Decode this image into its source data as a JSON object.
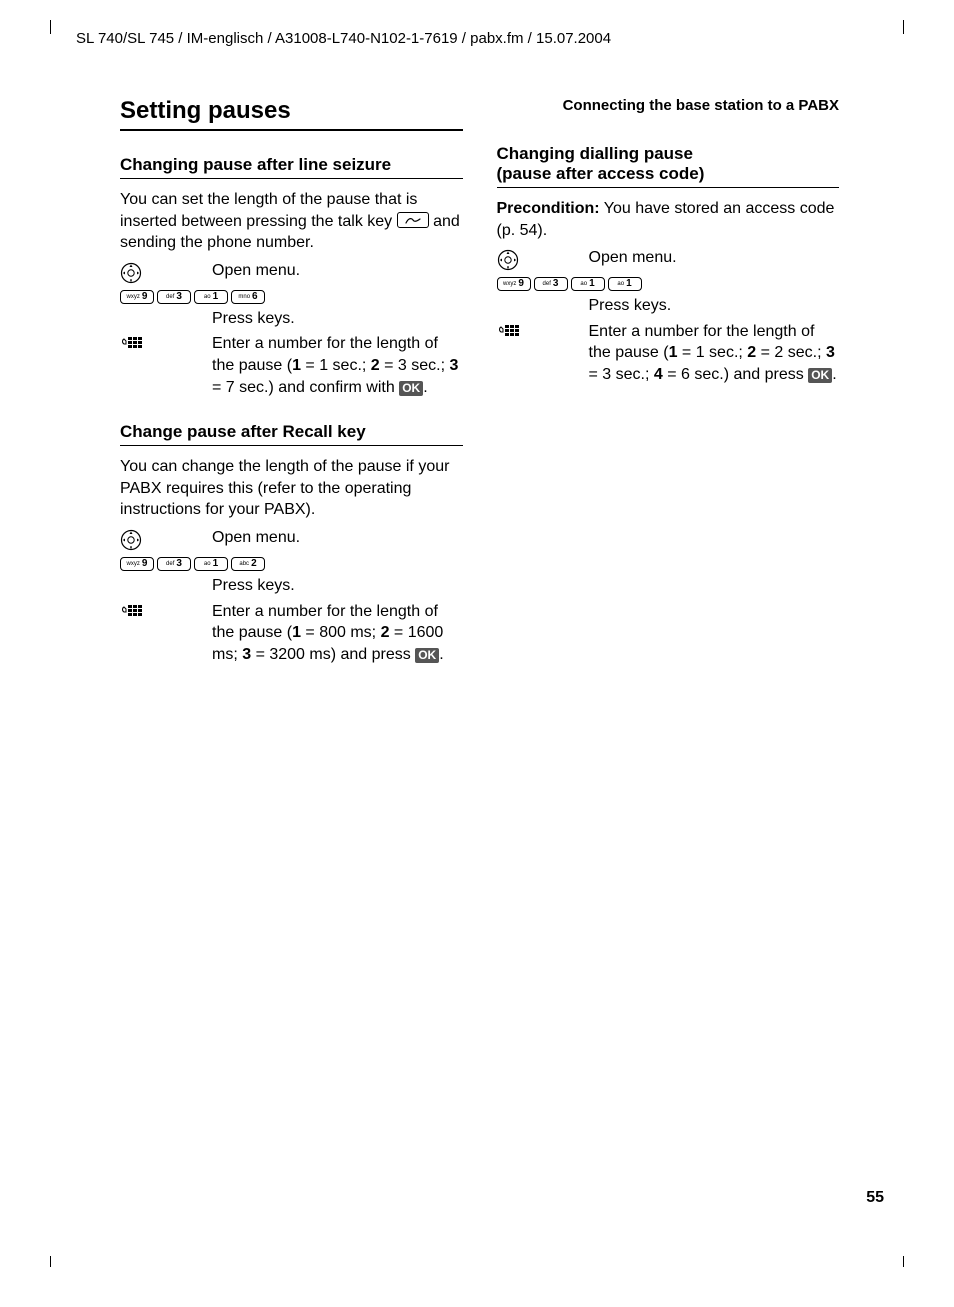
{
  "header": "SL 740/SL 745 / IM-englisch / A31008-L740-N102-1-7619 / pabx.fm / 15.07.2004",
  "running_head": "Connecting the base station to a PABX",
  "page_number": "55",
  "left": {
    "h1": "Setting pauses",
    "s1": {
      "title": "Changing pause after line seizure",
      "intro_a": "You can set the length of the pause that is inserted between pressing the talk key ",
      "intro_b": " and sending the phone number.",
      "open_menu": "Open menu.",
      "press_keys": "Press keys.",
      "enter_num_html": "Enter a number for the length of the pause (<b>1</b> = 1 sec.; <b>2</b> = 3 sec.; <b>3</b> = 7 sec.) and confirm with "
    },
    "s2": {
      "title": "Change pause after Recall key",
      "intro": "You can change the length of the pause if your PABX requires this (refer to the operating instructions for your PABX).",
      "open_menu": "Open menu.",
      "press_keys": "Press keys.",
      "enter_num_html": "Enter a number for the length of the pause (<b>1</b> = 800 ms; <b>2</b> = 1600 ms; <b>3</b> = 3200 ms) and press "
    }
  },
  "right": {
    "s1": {
      "title_l1": "Changing dialling pause",
      "title_l2": "(pause after access code)",
      "precond_label": "Precondition:",
      "precond_text": " You have stored an access code (p. 54).",
      "open_menu": "Open menu.",
      "press_keys": "Press keys.",
      "enter_num_html": "Enter a number for the length of the pause (<b>1</b> = 1 sec.; <b>2</b> = 2 sec.; <b>3</b> = 3 sec.; <b>4</b>  = 6 sec.) and press "
    }
  },
  "keys": {
    "k9": {
      "small": "wxyz",
      "big": "9"
    },
    "k3": {
      "small": "def",
      "big": "3"
    },
    "k1": {
      "small": "ao",
      "big": "1"
    },
    "k6": {
      "small": "mno",
      "big": "6"
    },
    "k2": {
      "small": "abc",
      "big": "2"
    }
  },
  "ok": "OK"
}
